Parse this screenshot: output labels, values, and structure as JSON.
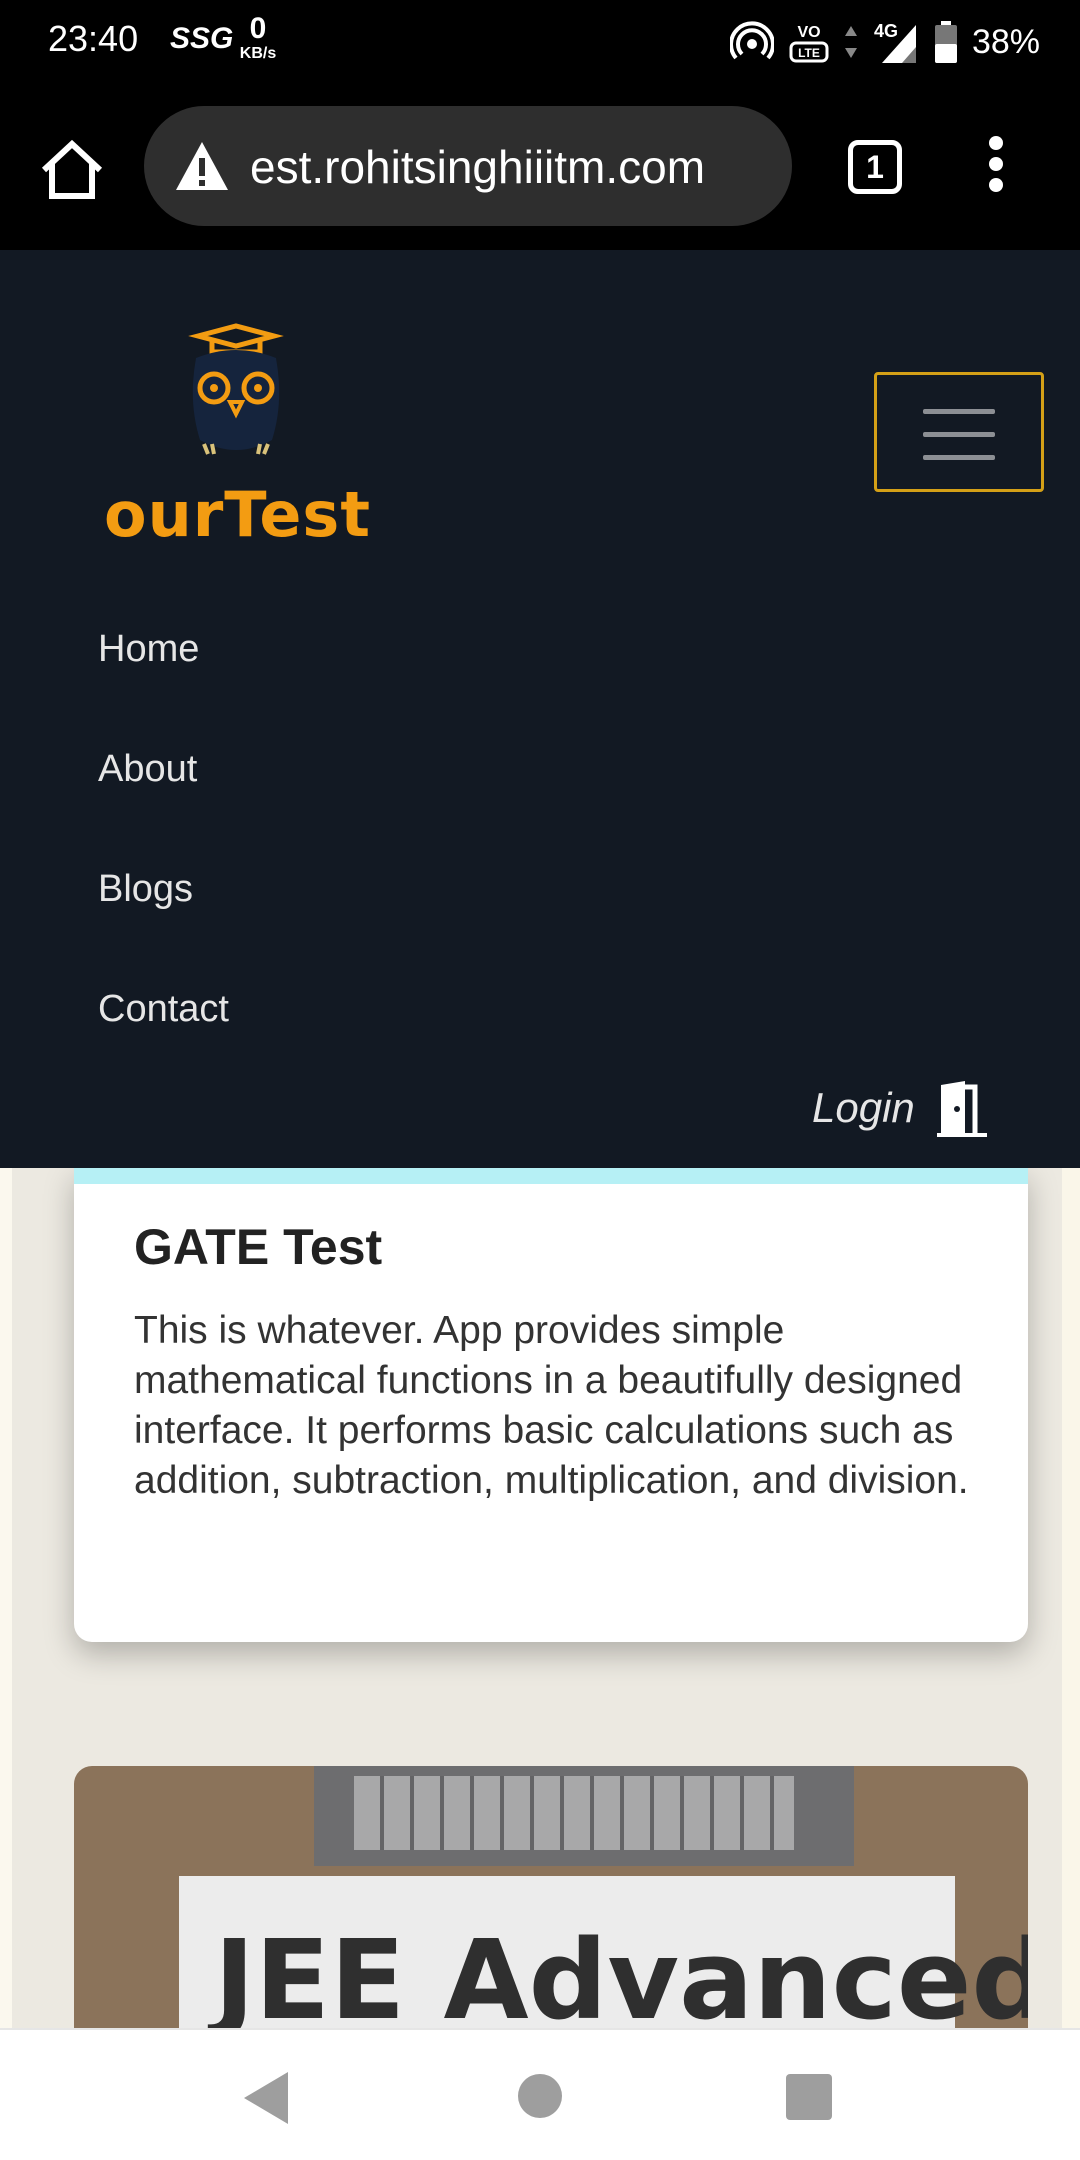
{
  "status_bar": {
    "time": "23:40",
    "carrier_tag": "SSG",
    "speed_value": "0",
    "speed_unit": "KB/s",
    "battery": "38%",
    "icons": [
      "hotspot-icon",
      "volte-icon",
      "data-arrows-icon",
      "4g-signal-icon",
      "battery-icon"
    ]
  },
  "browser": {
    "url": "est.rohitsinghiiitm.com",
    "tab_count": "1",
    "icons": [
      "home-icon",
      "warning-icon",
      "overflow-menu-icon"
    ]
  },
  "site": {
    "logo_text": "ourTest",
    "nav_items": [
      "Home",
      "About",
      "Blogs",
      "Contact"
    ],
    "login_label": "Login",
    "colors": {
      "nav_bg": "#121923",
      "brand": "#f39c12",
      "toggler_border": "#d4a017"
    }
  },
  "cards": [
    {
      "title": "GATE Test",
      "text": "This is whatever. App provides simple mathematical functions in a beautifully designed interface. It performs basic calculations such as addition, subtraction, multiplication, and division."
    },
    {
      "image_title": "JEE Advanced"
    }
  ],
  "system_nav": {
    "icons": [
      "back-icon",
      "home-circle-icon",
      "recents-icon"
    ]
  }
}
